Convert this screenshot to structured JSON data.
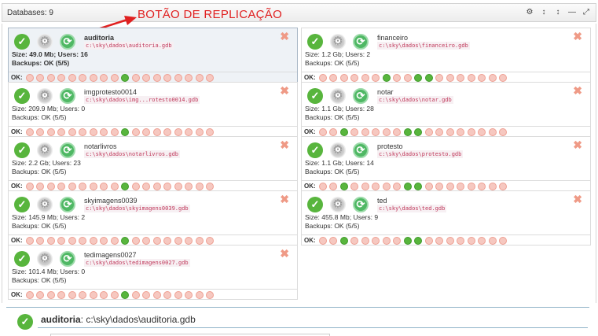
{
  "header": {
    "title": "Databases: 9",
    "tools": [
      {
        "icon": "gear-icon",
        "glyph": "⚙"
      },
      {
        "icon": "sort-icon",
        "glyph": "↕"
      },
      {
        "icon": "sort-alt-icon",
        "glyph": "↕"
      },
      {
        "icon": "minimize-icon",
        "glyph": "—"
      },
      {
        "icon": "expand-icon",
        "glyph": "⤢"
      }
    ]
  },
  "annotation": "BOTÃO DE REPLICAÇÃO",
  "colors": {
    "ok": "#58b53d",
    "error": "#f6c8c0",
    "path": "#c0395b",
    "annotation": "#e02020",
    "selected_bg": "#eef2f6"
  },
  "status_label": "OK:",
  "databases": [
    {
      "name": "auditoria",
      "path": "c:\\sky\\dados\\auditoria.gdb",
      "size": "Size: 49.0 Mb;",
      "users": "Users: 16",
      "backups": "Backups: OK (5/5)",
      "selected": true,
      "status": [
        0,
        0,
        0,
        0,
        0,
        0,
        0,
        0,
        0,
        1,
        0,
        0,
        0,
        0,
        0,
        0,
        0,
        0
      ]
    },
    {
      "name": "financeiro",
      "path": "c:\\sky\\dados\\financeiro.gdb",
      "size": "Size: 1.2 Gb;",
      "users": "Users: 2",
      "backups": "Backups: OK (5/5)",
      "selected": false,
      "status": [
        0,
        0,
        0,
        0,
        0,
        0,
        1,
        0,
        0,
        1,
        1,
        0,
        0,
        0,
        0,
        0,
        0,
        0
      ]
    },
    {
      "name": "imgprotesto0014",
      "path": "c:\\sky\\dados\\img...rotesto0014.gdb",
      "size": "Size: 209.9 Mb;",
      "users": "Users: 0",
      "backups": "Backups: OK (5/5)",
      "selected": false,
      "status": [
        0,
        0,
        0,
        0,
        0,
        0,
        0,
        0,
        0,
        1,
        0,
        0,
        0,
        0,
        0,
        0,
        0,
        0
      ]
    },
    {
      "name": "notar",
      "path": "c:\\sky\\dados\\notar.gdb",
      "size": "Size: 1.1 Gb;",
      "users": "Users: 28",
      "backups": "Backups: OK (5/5)",
      "selected": false,
      "status": [
        0,
        0,
        1,
        0,
        0,
        0,
        0,
        0,
        1,
        1,
        0,
        0,
        0,
        0,
        0,
        0,
        0,
        0
      ]
    },
    {
      "name": "notarlivros",
      "path": "c:\\sky\\dados\\notarlivros.gdb",
      "size": "Size: 2.2 Gb;",
      "users": "Users: 23",
      "backups": "Backups: OK (5/5)",
      "selected": false,
      "status": [
        0,
        0,
        0,
        0,
        0,
        0,
        0,
        0,
        0,
        1,
        0,
        0,
        0,
        0,
        0,
        0,
        0,
        0
      ]
    },
    {
      "name": "protesto",
      "path": "c:\\sky\\dados\\protesto.gdb",
      "size": "Size: 1.1 Gb;",
      "users": "Users: 14",
      "backups": "Backups: OK (5/5)",
      "selected": false,
      "status": [
        0,
        0,
        1,
        0,
        0,
        0,
        0,
        0,
        1,
        1,
        0,
        0,
        0,
        0,
        0,
        0,
        0,
        0
      ]
    },
    {
      "name": "skyimagens0039",
      "path": "c:\\sky\\dados\\skyimagens0039.gdb",
      "size": "Size: 145.9 Mb;",
      "users": "Users: 2",
      "backups": "Backups: OK (5/5)",
      "selected": false,
      "status": [
        0,
        0,
        0,
        0,
        0,
        0,
        0,
        0,
        0,
        1,
        0,
        0,
        0,
        0,
        0,
        0,
        0,
        0
      ]
    },
    {
      "name": "ted",
      "path": "c:\\sky\\dados\\ted.gdb",
      "size": "Size: 455.8 Mb;",
      "users": "Users: 9",
      "backups": "Backups: OK (5/5)",
      "selected": false,
      "status": [
        0,
        0,
        1,
        0,
        0,
        0,
        0,
        0,
        1,
        1,
        0,
        0,
        0,
        0,
        0,
        0,
        0,
        0
      ]
    },
    {
      "name": "tedimagens0027",
      "path": "c:\\sky\\dados\\tedimagens0027.gdb",
      "size": "Size: 101.4 Mb;",
      "users": "Users: 0",
      "backups": "Backups: OK (5/5)",
      "selected": false,
      "status": [
        0,
        0,
        0,
        0,
        0,
        0,
        0,
        0,
        0,
        1,
        0,
        0,
        0,
        0,
        0,
        0,
        0,
        0
      ]
    }
  ],
  "detail": {
    "name": "auditoria",
    "path": ": c:\\sky\\dados\\auditoria.gdb"
  }
}
